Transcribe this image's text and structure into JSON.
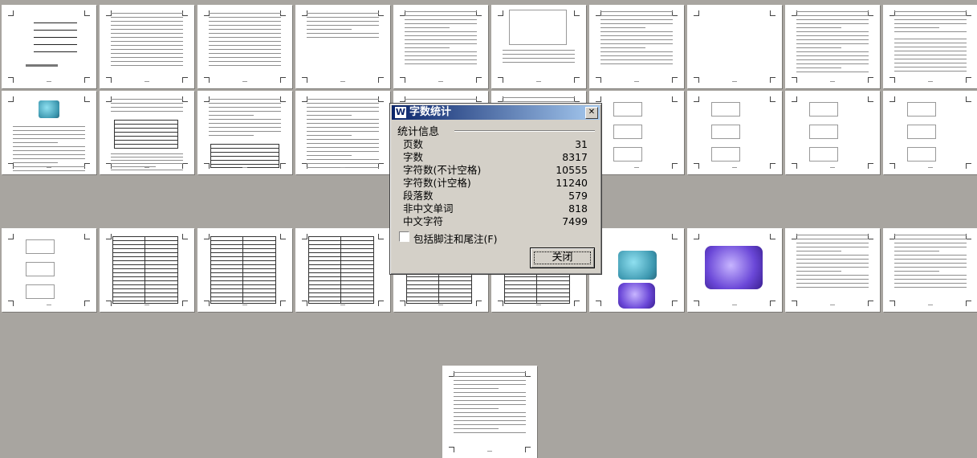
{
  "dialog": {
    "title": "字数统计",
    "app_icon_glyph": "W",
    "close_glyph": "✕",
    "group_label": "统计信息",
    "stats": [
      {
        "label": "页数",
        "value": "31"
      },
      {
        "label": "字数",
        "value": "8317"
      },
      {
        "label": "字符数(不计空格)",
        "value": "10555"
      },
      {
        "label": "字符数(计空格)",
        "value": "11240"
      },
      {
        "label": "段落数",
        "value": "579"
      },
      {
        "label": "非中文单词",
        "value": "818"
      },
      {
        "label": "中文字符",
        "value": "7499"
      }
    ],
    "checkbox_label": "包括脚注和尾注(F)",
    "checkbox_checked": false,
    "close_button_label": "关闭"
  },
  "document": {
    "page_count": 31,
    "background_color": "#a8a5a0",
    "title_bar_color": "#0a246a"
  }
}
